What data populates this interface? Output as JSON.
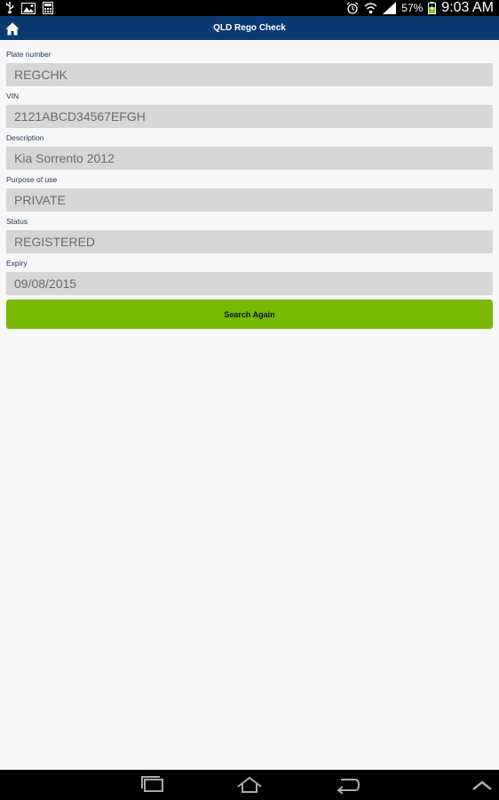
{
  "statusbar": {
    "battery": "57%",
    "time": "9:03 AM"
  },
  "appbar": {
    "title": "QLD Rego Check"
  },
  "fields": [
    {
      "label": "Plate number",
      "value": "REGCHK"
    },
    {
      "label": "VIN",
      "value": "2121ABCD34567EFGH"
    },
    {
      "label": "Description",
      "value": "Kia Sorrento 2012"
    },
    {
      "label": "Purpose of use",
      "value": "PRIVATE"
    },
    {
      "label": "Status",
      "value": "REGISTERED"
    },
    {
      "label": "Expiry",
      "value": "09/08/2015"
    }
  ],
  "search_button": {
    "label": "Search Again"
  },
  "colors": {
    "appbar": "#0b3a73",
    "button": "#77b800",
    "field_bg": "#d6d6d6"
  }
}
